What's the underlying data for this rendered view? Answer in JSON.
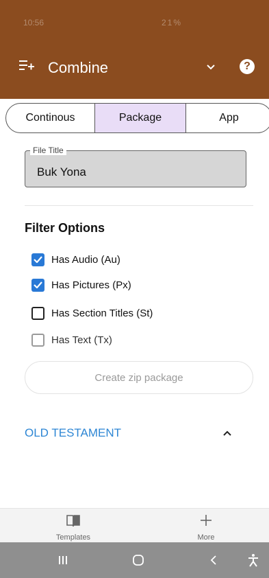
{
  "status_bar": {
    "time": "10:56",
    "icons_text": "21%"
  },
  "header": {
    "title": "Combine",
    "help_symbol": "?"
  },
  "tabs": [
    {
      "label": "Continous",
      "selected": false
    },
    {
      "label": "Package",
      "selected": true
    },
    {
      "label": "App",
      "selected": false
    }
  ],
  "file_title": {
    "label": "File Title",
    "value": "Buk Yona"
  },
  "filter": {
    "title": "Filter Options",
    "options": [
      {
        "label": "Has Audio (Au)",
        "checked": true
      },
      {
        "label": "Has Pictures (Px)",
        "checked": true
      },
      {
        "label": "Has Section Titles (St)",
        "checked": false
      },
      {
        "label": "Has Text (Tx)",
        "checked": false
      }
    ]
  },
  "zip_button": {
    "label": "Create zip package",
    "enabled": false
  },
  "section": {
    "label": "OLD TESTAMENT",
    "expanded": true
  },
  "bottom_nav": [
    {
      "label": "Templates",
      "icon": "book-icon"
    },
    {
      "label": "More",
      "icon": "plus-icon"
    }
  ],
  "colors": {
    "brand": "#8B4C1F",
    "accent": "#2979D6",
    "tab_selected": "#E9DDF7",
    "link": "#2D86D4"
  }
}
